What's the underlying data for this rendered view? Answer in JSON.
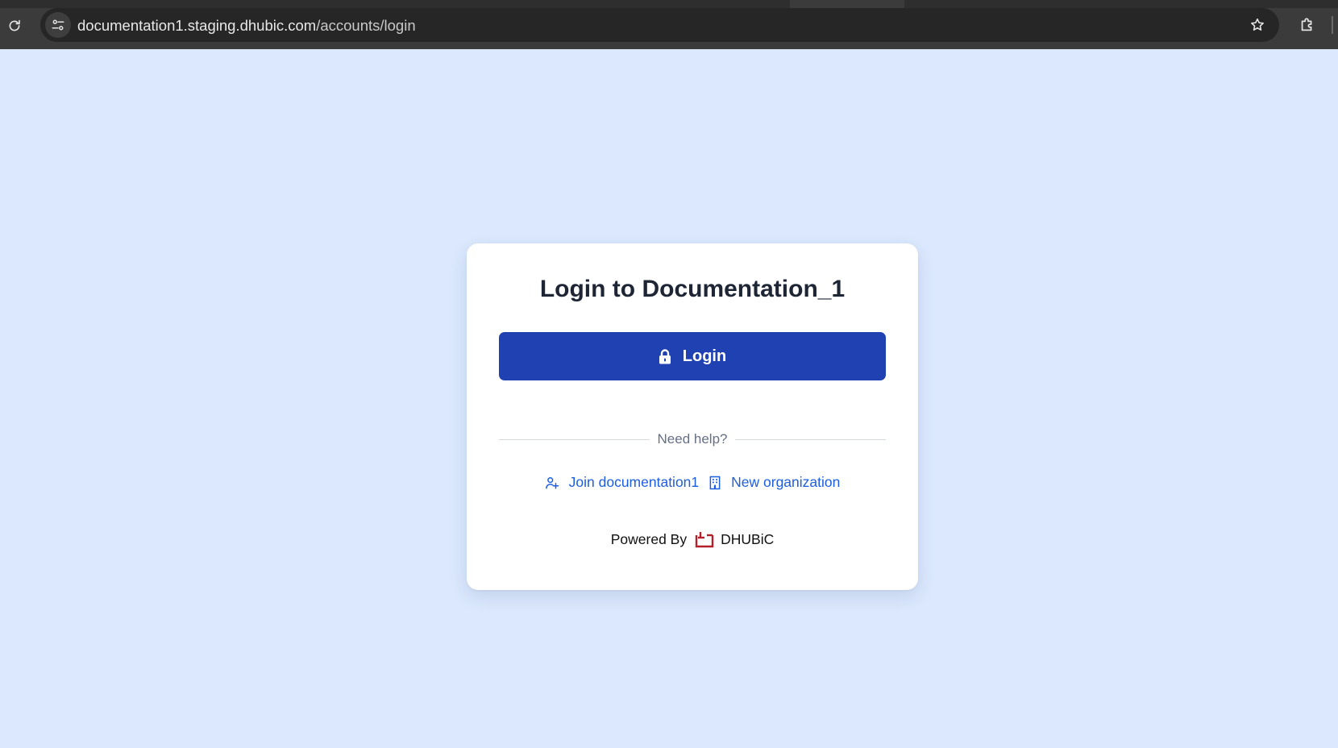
{
  "browser": {
    "url_host": "documentation1.staging.dhubic.com",
    "url_path": "/accounts/login"
  },
  "card": {
    "title": "Login to Documentation_1",
    "login_label": "Login",
    "help_text": "Need help?",
    "join_label": "Join documentation1",
    "new_org_label": "New organization",
    "powered_by_label": "Powered By",
    "brand_name": "DHUBiC"
  },
  "icons": {
    "reload": "reload-icon",
    "site_info": "tune-icon",
    "bookmark": "star-icon",
    "extensions": "puzzle-icon",
    "login": "lock-icon",
    "join": "user-plus-icon",
    "new_org": "building-icon",
    "brand": "dhubic-logo"
  },
  "colors": {
    "page_background": "#dbe8fd",
    "primary_button": "#1f41b1",
    "link": "#1d5ee0",
    "brand": "#b3202a"
  }
}
